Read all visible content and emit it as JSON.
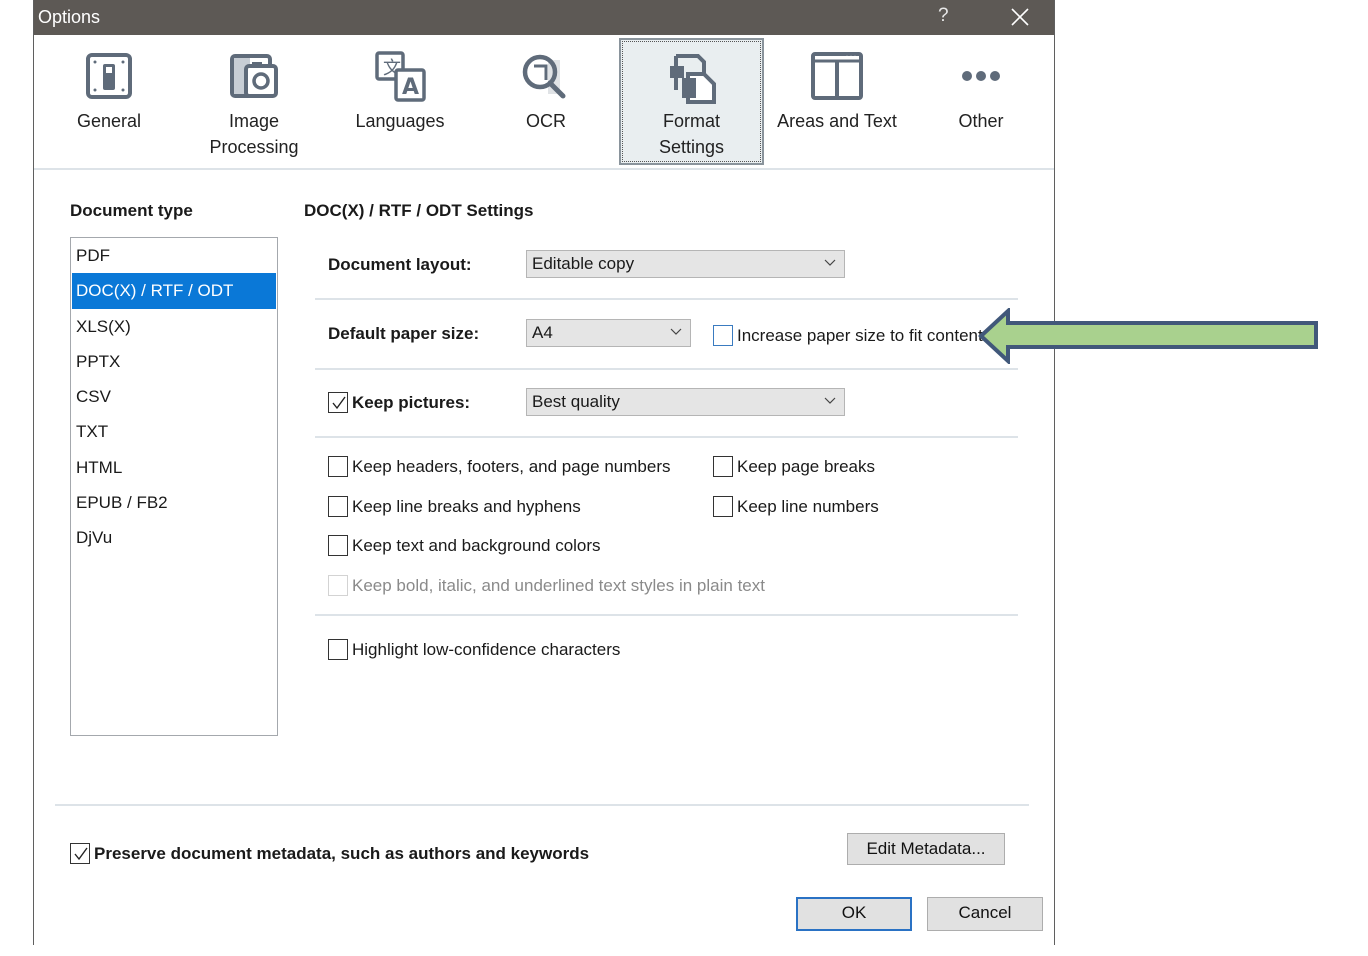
{
  "window": {
    "title": "Options",
    "help_label": "?",
    "close_icon": "close-icon"
  },
  "tabs": [
    {
      "label": "General",
      "icon": "switch-panel-icon",
      "active": false
    },
    {
      "label": "Image\nProcessing",
      "icon": "image-camera-icon",
      "active": false
    },
    {
      "label": "Languages",
      "icon": "translate-icon",
      "active": false
    },
    {
      "label": "OCR",
      "icon": "ocr-magnifier-icon",
      "active": false
    },
    {
      "label": "Format\nSettings",
      "icon": "format-documents-icon",
      "active": true
    },
    {
      "label": "Areas and Text",
      "icon": "columns-layout-icon",
      "active": false
    },
    {
      "label": "Other",
      "icon": "more-dots-icon",
      "active": false
    }
  ],
  "document_type": {
    "heading": "Document type",
    "items": [
      "PDF",
      "DOC(X) / RTF / ODT",
      "XLS(X)",
      "PPTX",
      "CSV",
      "TXT",
      "HTML",
      "EPUB / FB2",
      "DjVu"
    ],
    "selected_index": 1
  },
  "settings": {
    "heading": "DOC(X) / RTF / ODT Settings",
    "document_layout": {
      "label": "Document layout:",
      "value": "Editable copy"
    },
    "paper_size": {
      "label": "Default paper size:",
      "value": "A4"
    },
    "increase_paper": {
      "label": "Increase paper size to fit content",
      "checked": false
    },
    "keep_pictures": {
      "label": "Keep pictures:",
      "checked": true,
      "value": "Best quality"
    },
    "options": [
      {
        "label": "Keep headers, footers, and page numbers",
        "checked": false,
        "enabled": true
      },
      {
        "label": "Keep page breaks",
        "checked": false,
        "enabled": true
      },
      {
        "label": "Keep line breaks and hyphens",
        "checked": false,
        "enabled": true
      },
      {
        "label": "Keep line numbers",
        "checked": false,
        "enabled": true
      },
      {
        "label": "Keep text and background colors",
        "checked": false,
        "enabled": true
      },
      {
        "label": "Keep bold, italic, and underlined text styles in plain text",
        "checked": false,
        "enabled": false
      }
    ],
    "highlight": {
      "label": "Highlight low-confidence characters",
      "checked": false
    }
  },
  "footer": {
    "preserve_metadata": {
      "label": "Preserve document metadata, such as authors and keywords",
      "checked": true
    },
    "edit_metadata_label": "Edit Metadata...",
    "ok_label": "OK",
    "cancel_label": "Cancel"
  },
  "annotation": {
    "arrow_color": "#a9d18e",
    "arrow_border": "#41587a",
    "points_to": "Increase paper size to fit content"
  }
}
